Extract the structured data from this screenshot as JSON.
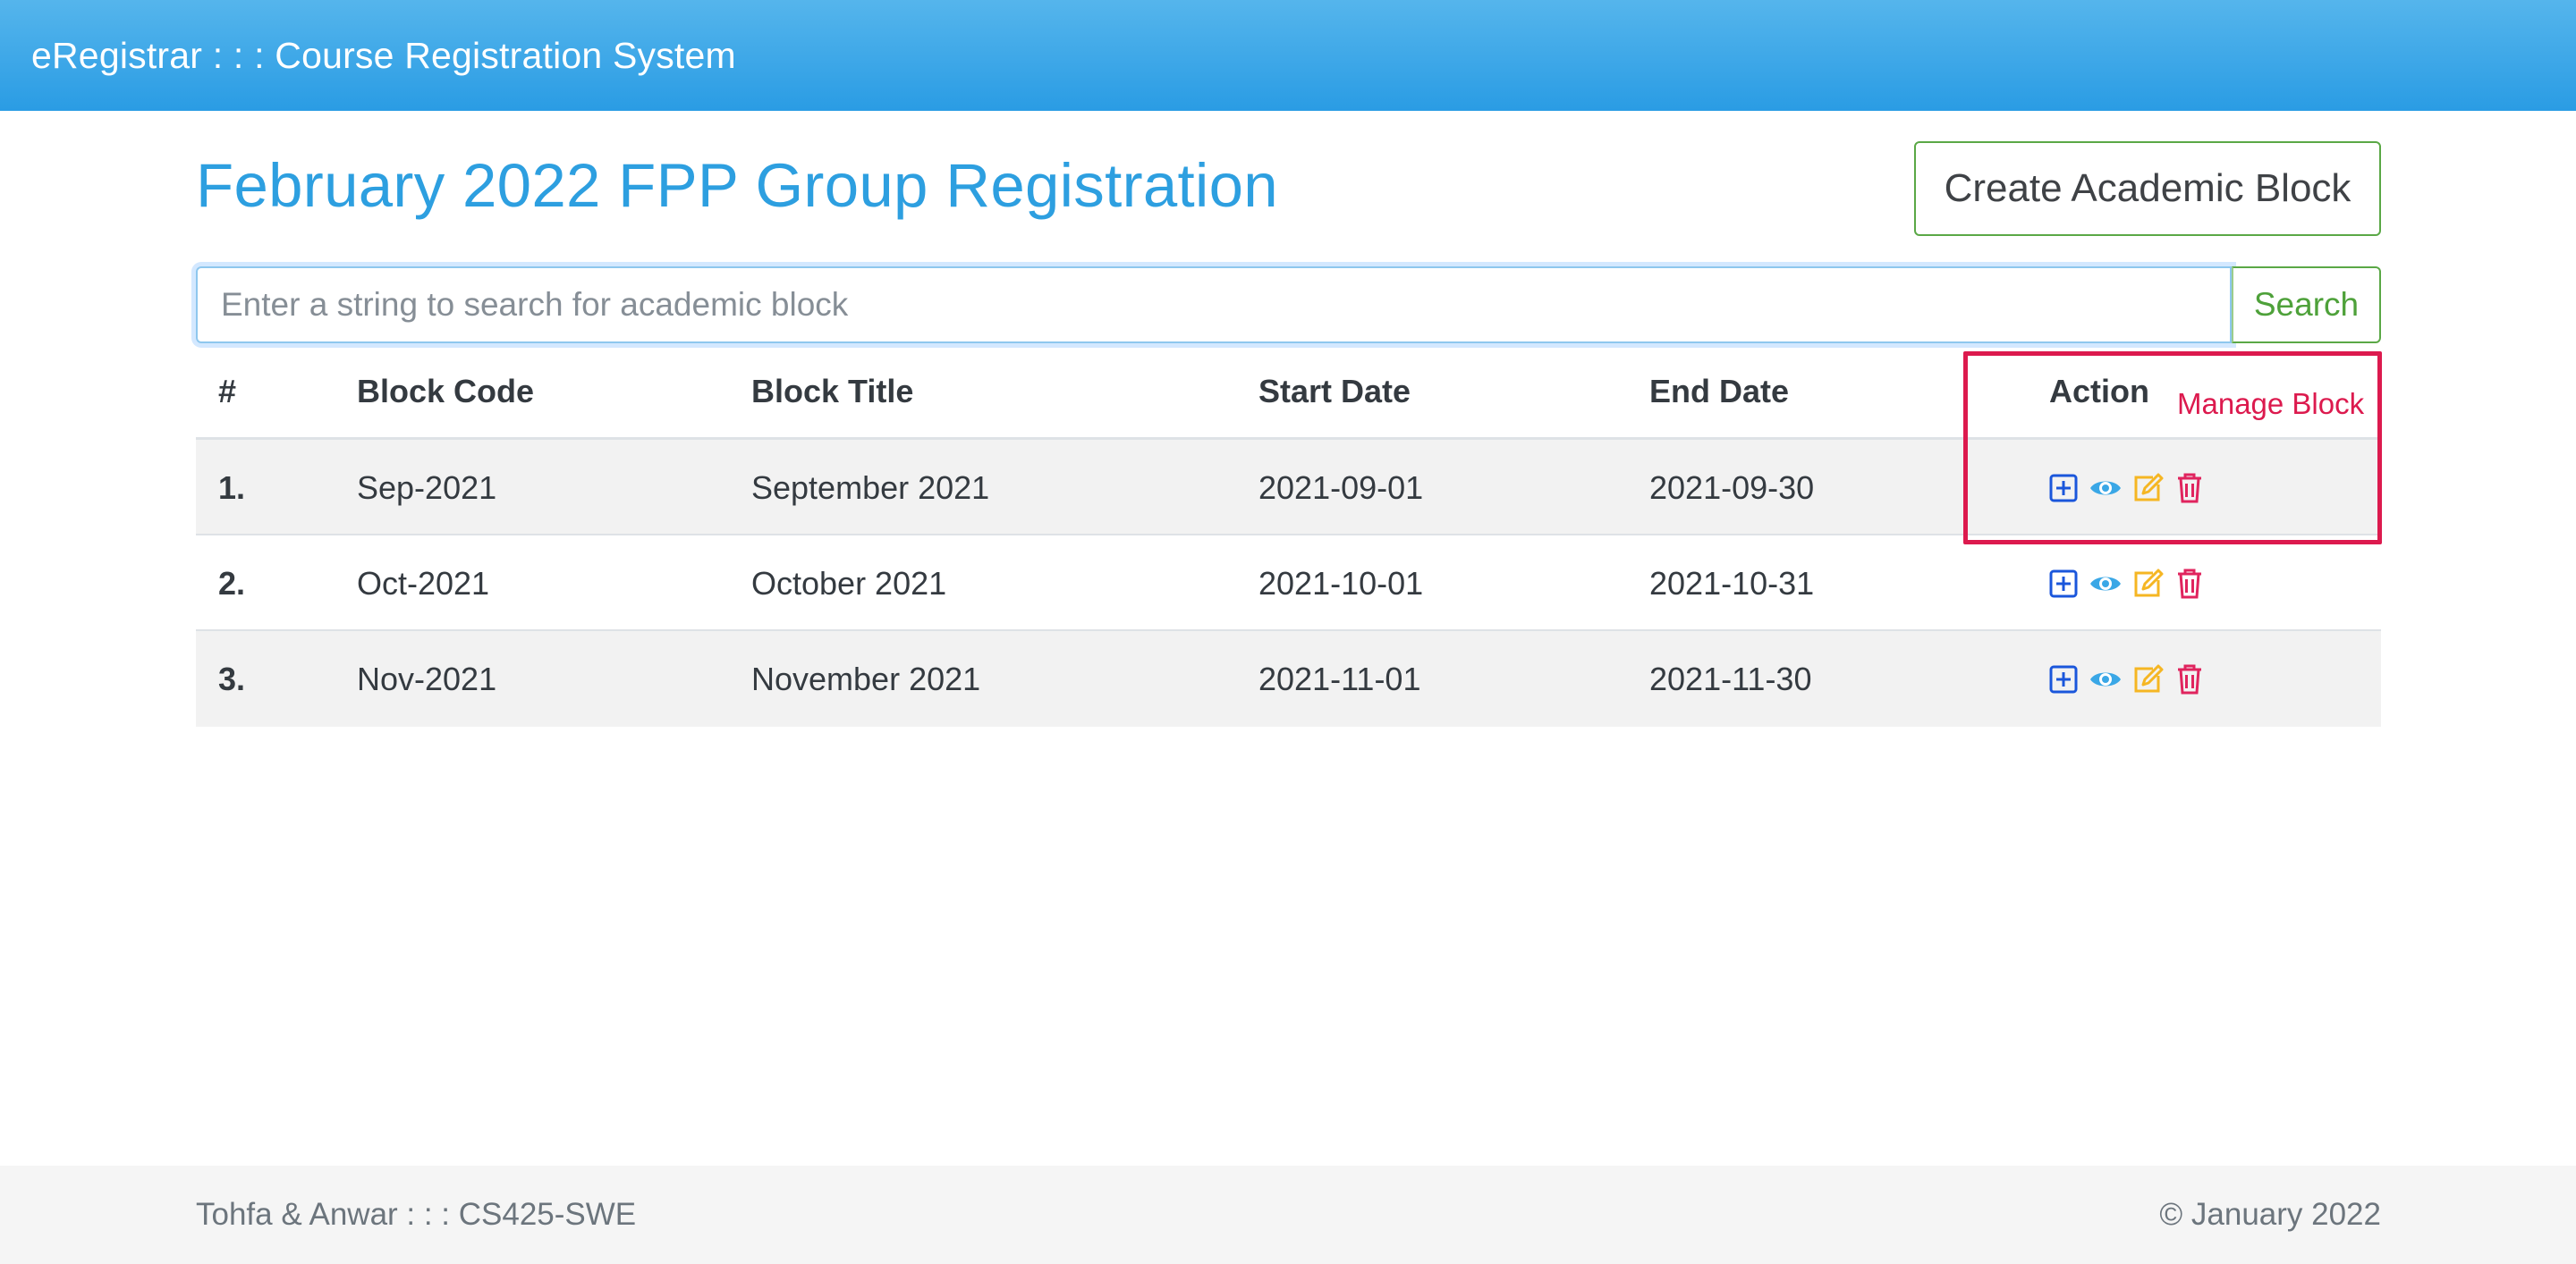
{
  "navbar": {
    "brand": "eRegistrar : : : Course Registration System"
  },
  "page": {
    "title": "February 2022 FPP Group Registration"
  },
  "toolbar": {
    "create_label": "Create Academic Block"
  },
  "search": {
    "placeholder": "Enter a string to search for academic block",
    "value": "",
    "button_label": "Search"
  },
  "table": {
    "headers": [
      "#",
      "Block Code",
      "Block Title",
      "Start Date",
      "End Date",
      "Action"
    ],
    "rows": [
      {
        "num": "1.",
        "code": "Sep-2021",
        "title": "September 2021",
        "start": "2021-09-01",
        "end": "2021-09-30"
      },
      {
        "num": "2.",
        "code": "Oct-2021",
        "title": "October 2021",
        "start": "2021-10-01",
        "end": "2021-10-31"
      },
      {
        "num": "3.",
        "code": "Nov-2021",
        "title": "November 2021",
        "start": "2021-11-01",
        "end": "2021-11-30"
      }
    ],
    "action_icons": [
      "plus-square-icon",
      "eye-icon",
      "edit-icon",
      "trash-icon"
    ]
  },
  "annotation": {
    "label": "Manage Block",
    "color": "#dc1a4e"
  },
  "footer": {
    "left": "Tohfa & Anwar : : : CS425-SWE",
    "right": "© January 2022"
  },
  "colors": {
    "navbar": "#2a9ce4",
    "title": "#2d9fe0",
    "success": "#5aa846",
    "add_icon": "#1a56db",
    "view_icon": "#3aa7e6",
    "edit_icon": "#f5b623",
    "delete_icon": "#e0245e"
  }
}
